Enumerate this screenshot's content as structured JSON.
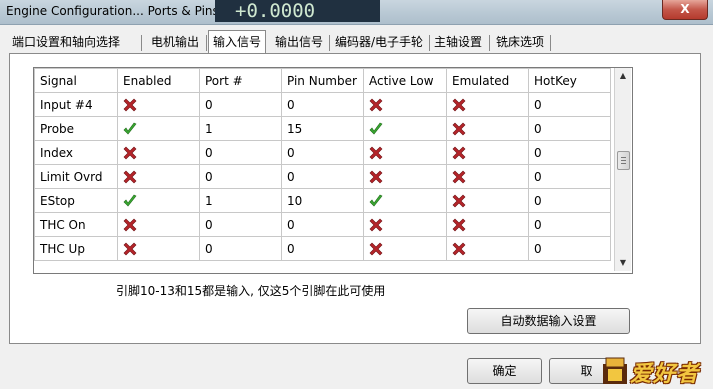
{
  "window": {
    "title": "Engine Configuration... Ports & Pins",
    "background_readout": "+0.0000",
    "close_glyph": "X"
  },
  "tabs": [
    {
      "label": "端口设置和轴向选择",
      "active": false
    },
    {
      "label": "电机输出",
      "active": false
    },
    {
      "label": "输入信号",
      "active": true
    },
    {
      "label": "输出信号",
      "active": false
    },
    {
      "label": "编码器/电子手轮",
      "active": false
    },
    {
      "label": "主轴设置",
      "active": false
    },
    {
      "label": "铣床选项",
      "active": false
    }
  ],
  "grid": {
    "columns": [
      "Signal",
      "Enabled",
      "Port #",
      "Pin Number",
      "Active Low",
      "Emulated",
      "HotKey"
    ],
    "rows": [
      {
        "signal": "Input #4",
        "enabled": false,
        "port": "0",
        "pin": "0",
        "active_low": false,
        "emulated": false,
        "hotkey": "0"
      },
      {
        "signal": "Probe",
        "enabled": true,
        "port": "1",
        "pin": "15",
        "active_low": true,
        "emulated": false,
        "hotkey": "0"
      },
      {
        "signal": "Index",
        "enabled": false,
        "port": "0",
        "pin": "0",
        "active_low": false,
        "emulated": false,
        "hotkey": "0"
      },
      {
        "signal": "Limit Ovrd",
        "enabled": false,
        "port": "0",
        "pin": "0",
        "active_low": false,
        "emulated": false,
        "hotkey": "0"
      },
      {
        "signal": "EStop",
        "enabled": true,
        "port": "1",
        "pin": "10",
        "active_low": true,
        "emulated": false,
        "hotkey": "0"
      },
      {
        "signal": "THC On",
        "enabled": false,
        "port": "0",
        "pin": "0",
        "active_low": false,
        "emulated": false,
        "hotkey": "0"
      },
      {
        "signal": "THC Up",
        "enabled": false,
        "port": "0",
        "pin": "0",
        "active_low": false,
        "emulated": false,
        "hotkey": "0"
      }
    ],
    "icons": {
      "true": "green-check-icon",
      "false": "red-x-icon"
    },
    "colors": {
      "check": "#3aa832",
      "cross": "#b5252a"
    }
  },
  "scrollbar": {
    "up_glyph": "▲",
    "down_glyph": "▼"
  },
  "note": "引脚10-13和15都是输入, 仅这5个引脚在此可使用",
  "buttons": {
    "auto_input": "自动数据输入设置",
    "ok": "确定",
    "cancel": "取"
  },
  "watermark": {
    "text": "爱好者"
  }
}
